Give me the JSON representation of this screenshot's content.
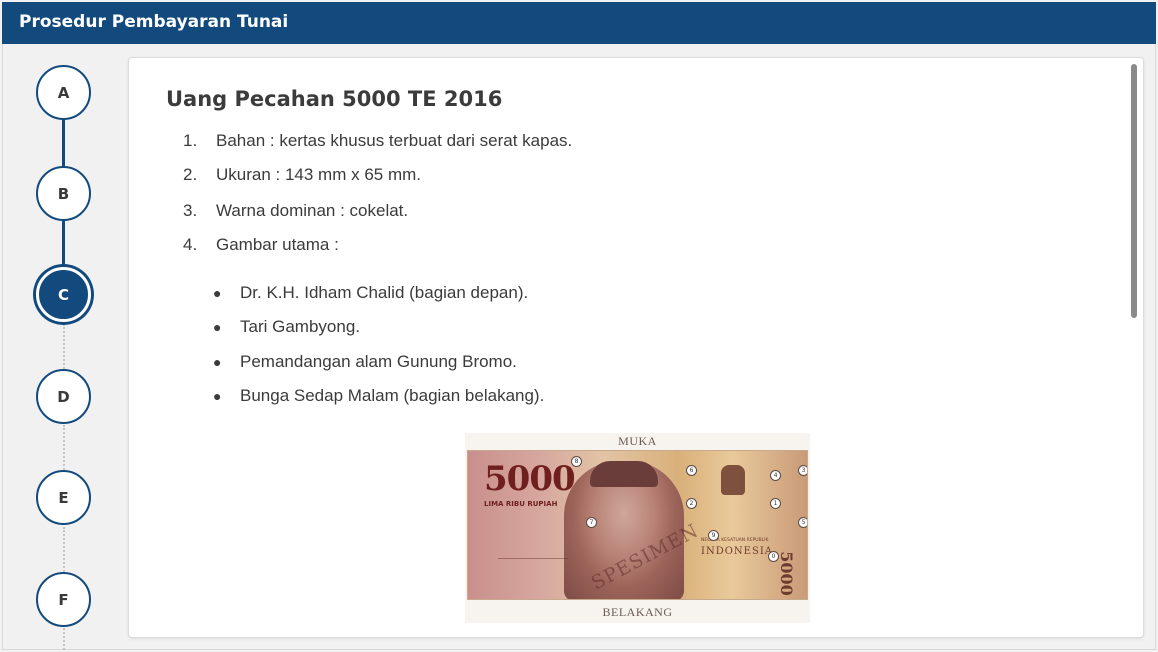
{
  "header": {
    "title": "Prosedur Pembayaran Tunai"
  },
  "steps": [
    {
      "label": "A",
      "active": false
    },
    {
      "label": "B",
      "active": false
    },
    {
      "label": "C",
      "active": true
    },
    {
      "label": "D",
      "active": false
    },
    {
      "label": "E",
      "active": false
    },
    {
      "label": "F",
      "active": false
    }
  ],
  "content": {
    "title": "Uang Pecahan 5000 TE 2016",
    "ordered": [
      {
        "num": "1.",
        "text": "Bahan : kertas khusus terbuat dari serat kapas."
      },
      {
        "num": "2.",
        "text": "Ukuran : 143 mm x 65 mm."
      },
      {
        "num": "3.",
        "text": "Warna dominan : cokelat."
      },
      {
        "num": "4.",
        "text": "Gambar utama :"
      }
    ],
    "bullets": [
      "Dr. K.H. Idham Chalid (bagian depan).",
      "Tari Gambyong.",
      "Pemandangan alam Gunung Bromo.",
      "Bunga Sedap Malam (bagian belakang)."
    ]
  },
  "banknote": {
    "top_label": "MUKA",
    "bottom_label": "BELAKANG",
    "denomination": "5000",
    "denomination_words": "LIMA RIBU RUPIAH",
    "country_small": "NEGARA KESATUAN REPUBLIK",
    "country": "INDONESIA",
    "watermark": "SPESIMEN",
    "marker_digits": [
      "8",
      "6",
      "4",
      "3",
      "2",
      "1",
      "5",
      "7",
      "9",
      "0"
    ]
  },
  "colors": {
    "primary": "#124a7d",
    "background": "#f1f1f2",
    "text": "#3b3b3b"
  }
}
